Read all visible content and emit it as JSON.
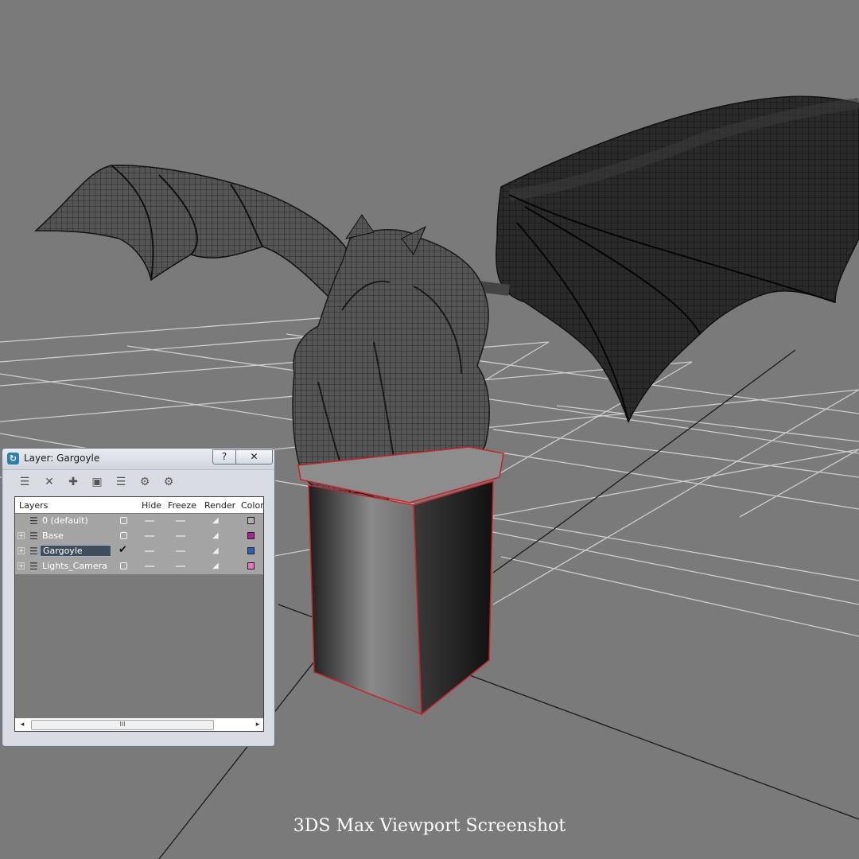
{
  "caption": "3DS Max Viewport Screenshot",
  "dialog": {
    "title": "Layer: Gargoyle",
    "help_label": "?",
    "close_label": "✕",
    "toolbar_icons": [
      "create-layer-icon",
      "delete-layer-icon",
      "add-to-layer-icon",
      "select-objects-icon",
      "highlight-layer-icon",
      "hide-all-icon",
      "freeze-all-icon"
    ],
    "columns": [
      "Layers",
      "Hide",
      "Freeze",
      "Render",
      "Color"
    ],
    "layers": [
      {
        "name": "0 (default)",
        "current": false,
        "color": "#b0b0b0"
      },
      {
        "name": "Base",
        "current": false,
        "color": "#b0209c"
      },
      {
        "name": "Gargoyle",
        "current": true,
        "color": "#2a5fbf"
      },
      {
        "name": "Lights_Camera",
        "current": false,
        "color": "#f070c8"
      }
    ],
    "scroll": {
      "left": "◂",
      "right": "▸",
      "thumb": "III"
    }
  },
  "colors": {
    "viewport_bg": "#7a7a7a",
    "grid_lines": "#d8d8d8",
    "selection_outline": "#c8232a"
  }
}
